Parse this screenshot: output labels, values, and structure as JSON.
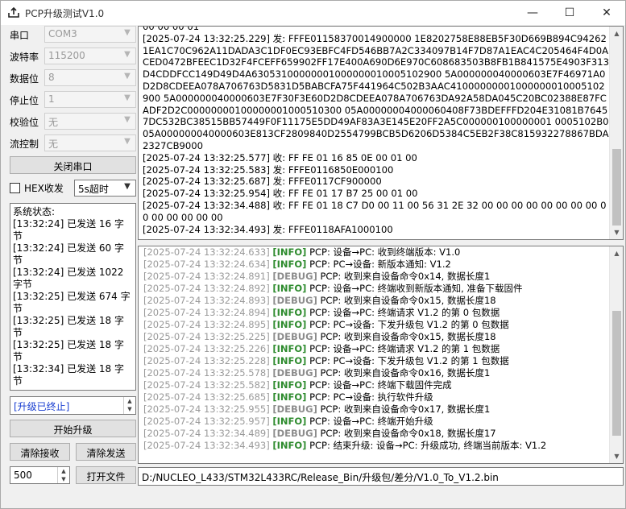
{
  "window": {
    "title": "PCP升级测试V1.0",
    "minimize": "—",
    "maximize": "☐",
    "close": "✕",
    "app_icon": "upload-icon"
  },
  "settings": {
    "port_label": "串口",
    "port_value": "COM3",
    "baud_label": "波特率",
    "baud_value": "115200",
    "databits_label": "数据位",
    "databits_value": "8",
    "stopbits_label": "停止位",
    "stopbits_value": "1",
    "parity_label": "校验位",
    "parity_value": "无",
    "flow_label": "流控制",
    "flow_value": "无",
    "close_port_label": "关闭串口",
    "hex_label": "HEX收发",
    "timeout_value": "5s超时"
  },
  "status": {
    "lines": [
      "系统状态:",
      "[13:32:24] 已发送 16 字节",
      "[13:32:24] 已发送 60 字节",
      "[13:32:24] 已发送 1022 字节",
      "[13:32:25] 已发送 674 字节",
      "[13:32:25] 已发送 18 字节",
      "[13:32:25] 已发送 18 字节",
      "[13:32:34] 已发送 18 字节"
    ]
  },
  "upgrade": {
    "state_text": "[升级已终止]",
    "start_label": "开始升级",
    "clear_rx_label": "清除接收",
    "clear_tx_label": "清除发送",
    "count_value": "500",
    "open_file_label": "打开文件"
  },
  "rx_lines": [
    "00 00 00 01",
    "[2025-07-24 13:32:25.229] 发: FFFE01158370014900000 1E8202758E88EB5F30D669B894C942621EA1C70C962A11DADA3C1DF0EC93EBFC4FD546BB7A2C334097B14F7D87A1EAC4C205464F4D0ACED0472BFEEC1D32F4FCEFF659902FF17E400A690D6E970C608683503B8FB1B841575E4903F313D4CDDFCC149D49D4A63053100000001000000010005102900 5A000000040000603E7F46971A0D2D8CDEEA078A706763D5831D5BABCFA75F441964C502B3AAC41000000001000000010005102900 5A000000040000603E7F30F3E60D2D8CDEEA078A706763DA92A58DA045C20BC02388E87FCADF2D2C00000000100000001000510300 05A00000004000060408F73BDEFFFD204E31081B76457DC532BC38515BB57449F0F11175E5DD49AF83A3E145E20FF2A5C000000100000001 0005102B005A000000040000603E813CF2809840D2554799BCB5D6206D5384C5EB2F38C815932278867BDA2327CB9000",
    "[2025-07-24 13:32:25.577] 收: FF FE 01 16 85 0E 00 01 00",
    "[2025-07-24 13:32:25.583] 发: FFFE0116850E000100",
    "[2025-07-24 13:32:25.687] 发: FFFE0117CF900000",
    "[2025-07-24 13:32:25.954] 收: FF FE 01 17 B7 25 00 01 00",
    "[2025-07-24 13:32:34.488] 收: FF FE 01 18 C7 D0 00 11 00 56 31 2E 32 00 00 00 00 00 00 00 00 00 00 00 00 00 00",
    "[2025-07-24 13:32:34.493] 发: FFFE0118AFA1000100"
  ],
  "log_lines": [
    {
      "ts": "[2025-07-24 13:32:24.633]",
      "level": "[INFO]",
      "msg": " PCP: 设备→PC: 收到终端版本: V1.0"
    },
    {
      "ts": "[2025-07-24 13:32:24.634]",
      "level": "[INFO]",
      "msg": " PCP: PC→设备: 新版本通知: V1.2"
    },
    {
      "ts": "[2025-07-24 13:32:24.891]",
      "level": "[DEBUG]",
      "msg": " PCP: 收到来自设备命令0x14, 数据长度1"
    },
    {
      "ts": "[2025-07-24 13:32:24.892]",
      "level": "[INFO]",
      "msg": " PCP: 设备→PC: 终端收到新版本通知, 准备下载固件"
    },
    {
      "ts": "[2025-07-24 13:32:24.893]",
      "level": "[DEBUG]",
      "msg": " PCP: 收到来自设备命令0x15, 数据长度18"
    },
    {
      "ts": "[2025-07-24 13:32:24.894]",
      "level": "[INFO]",
      "msg": " PCP: 设备→PC: 终端请求 V1.2 的第 0 包数据"
    },
    {
      "ts": "[2025-07-24 13:32:24.895]",
      "level": "[INFO]",
      "msg": " PCP: PC→设备: 下发升级包 V1.2 的第 0 包数据"
    },
    {
      "ts": "[2025-07-24 13:32:25.225]",
      "level": "[DEBUG]",
      "msg": " PCP: 收到来自设备命令0x15, 数据长度18"
    },
    {
      "ts": "[2025-07-24 13:32:25.226]",
      "level": "[INFO]",
      "msg": " PCP: 设备→PC: 终端请求 V1.2 的第 1 包数据"
    },
    {
      "ts": "[2025-07-24 13:32:25.228]",
      "level": "[INFO]",
      "msg": " PCP: PC→设备: 下发升级包 V1.2 的第 1 包数据"
    },
    {
      "ts": "[2025-07-24 13:32:25.578]",
      "level": "[DEBUG]",
      "msg": " PCP: 收到来自设备命令0x16, 数据长度1"
    },
    {
      "ts": "[2025-07-24 13:32:25.582]",
      "level": "[INFO]",
      "msg": " PCP: 设备→PC: 终端下载固件完成"
    },
    {
      "ts": "[2025-07-24 13:32:25.685]",
      "level": "[INFO]",
      "msg": " PCP: PC→设备: 执行软件升级"
    },
    {
      "ts": "[2025-07-24 13:32:25.955]",
      "level": "[DEBUG]",
      "msg": " PCP: 收到来自设备命令0x17, 数据长度1"
    },
    {
      "ts": "[2025-07-24 13:32:25.957]",
      "level": "[INFO]",
      "msg": " PCP: 设备→PC: 终端开始升级"
    },
    {
      "ts": "[2025-07-24 13:32:34.489]",
      "level": "[DEBUG]",
      "msg": " PCP: 收到来自设备命令0x18, 数据长度17"
    },
    {
      "ts": "[2025-07-24 13:32:34.493]",
      "level": "[INFO]",
      "msg": " PCP: 结束升级: 设备→PC: 升级成功, 终端当前版本: V1.2"
    }
  ],
  "file_path": "D:/NUCLEO_L433/STM32L433RC/Release_Bin/升级包/差分/V1.0_To_V1.2.bin"
}
